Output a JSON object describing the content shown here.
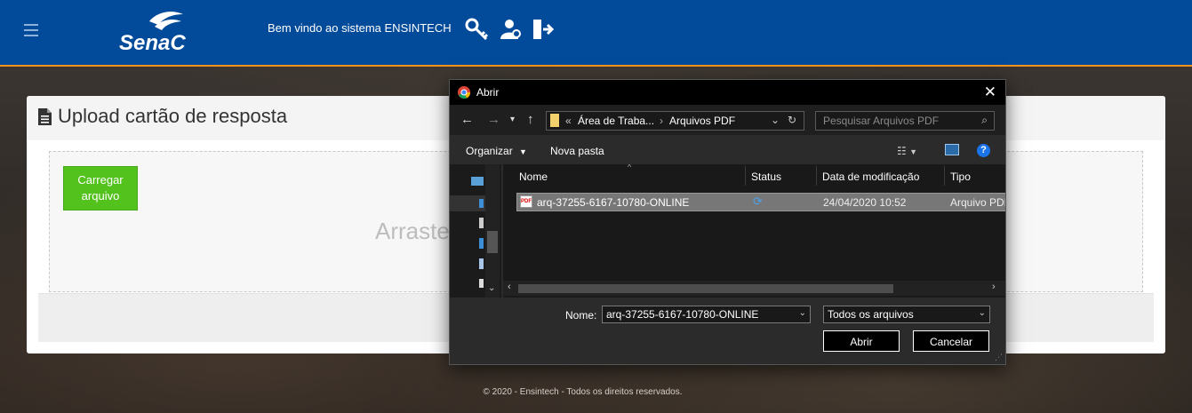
{
  "header": {
    "logo_text": "Senac",
    "welcome": "Bem vindo ao sistema ENSINTECH",
    "icons": [
      "key-icon",
      "users-gear-icon",
      "logout-icon"
    ]
  },
  "card": {
    "title": "Upload cartão de resposta",
    "upload_button": "Carregar arquivo",
    "drop_hint": "Arraste"
  },
  "footer": {
    "text": "© 2020 - Ensintech - Todos os direitos reservados."
  },
  "dialog": {
    "title": "Abrir",
    "address": {
      "prefix": "«",
      "crumb1": "Área de Traba...",
      "crumb2": "Arquivos PDF"
    },
    "search_placeholder": "Pesquisar Arquivos PDF",
    "toolbar": {
      "organize": "Organizar",
      "new_folder": "Nova pasta"
    },
    "columns": {
      "name": "Nome",
      "status": "Status",
      "date": "Data de modificação",
      "type": "Tipo"
    },
    "files": [
      {
        "name": "arq-37255-6167-10780-ONLINE",
        "date": "24/04/2020 10:52",
        "type": "Arquivo PDF"
      }
    ],
    "filename_label": "Nome:",
    "filename_value": "arq-37255-6167-10780-ONLINE",
    "filetype_value": "Todos os arquivos",
    "open_button": "Abrir",
    "cancel_button": "Cancelar"
  },
  "colors": {
    "header_bg": "#024a9a",
    "header_accent": "#f7931d",
    "upload_button": "#53c21d",
    "dialog_bg": "#2b2b2b"
  }
}
